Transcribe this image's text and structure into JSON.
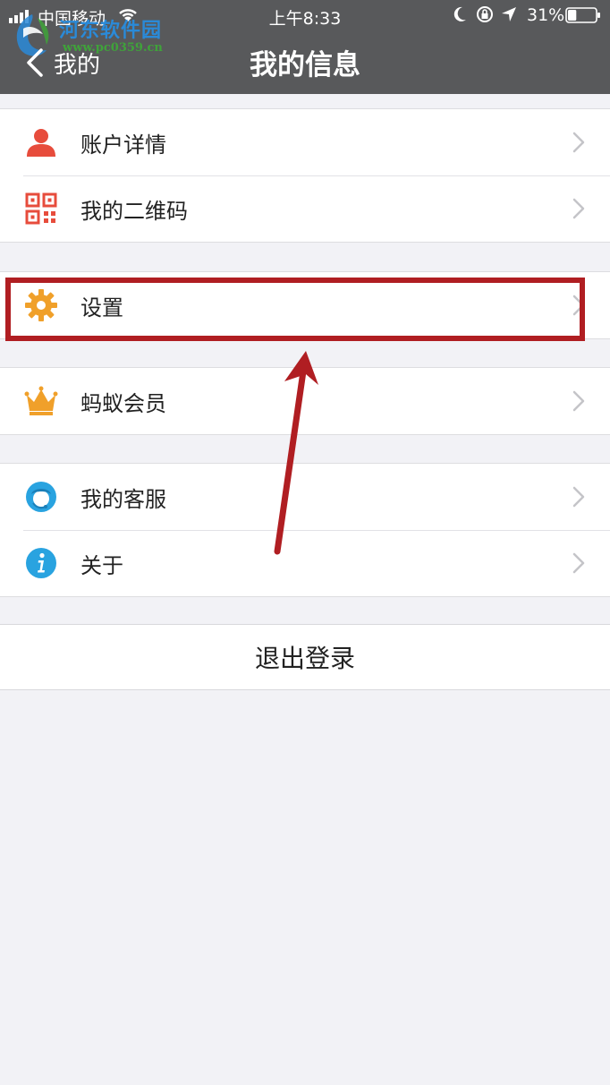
{
  "status": {
    "carrier": "中国移动",
    "time": "上午8:33",
    "battery_pct": "31%",
    "battery_level": 0.31,
    "icons": [
      "signal-icon",
      "wifi-icon",
      "moon-icon",
      "rotation-lock-icon",
      "location-icon",
      "battery-icon"
    ]
  },
  "watermark": {
    "text": "河东软件园",
    "url": "www.pc0359.cn"
  },
  "nav": {
    "back_label": "我的",
    "title": "我的信息"
  },
  "menu": {
    "groups": [
      {
        "items": [
          {
            "label": "账户详情",
            "icon": "person-icon",
            "color": "#e74c3c"
          },
          {
            "label": "我的二维码",
            "icon": "qrcode-icon",
            "color": "#e74c3c"
          }
        ]
      },
      {
        "items": [
          {
            "label": "设置",
            "icon": "gear-icon",
            "color": "#f0a02a"
          }
        ]
      },
      {
        "items": [
          {
            "label": "蚂蚁会员",
            "icon": "crown-icon",
            "color": "#f0a02a"
          }
        ]
      },
      {
        "items": [
          {
            "label": "我的客服",
            "icon": "customer-service-icon",
            "color": "#29a3e0"
          },
          {
            "label": "关于",
            "icon": "info-icon",
            "color": "#29a3e0"
          }
        ]
      }
    ]
  },
  "logout_label": "退出登录",
  "annotation": {
    "highlight_color": "#b01e22"
  }
}
